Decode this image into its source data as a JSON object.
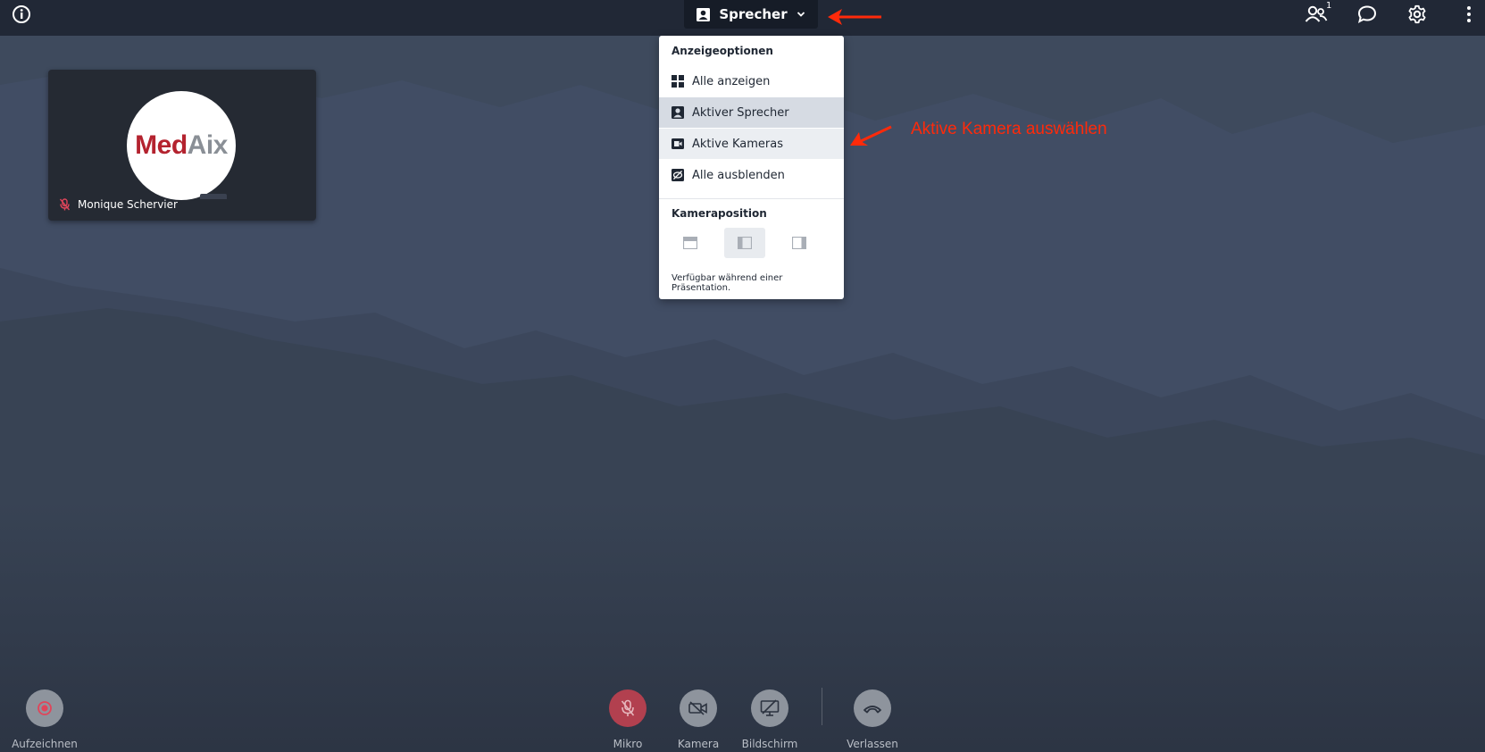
{
  "topbar": {
    "view_button_label": "Sprecher",
    "participants_count": "1",
    "icons": [
      "info-icon",
      "speaker-view-icon",
      "chevron-down-icon",
      "participants-icon",
      "chat-icon",
      "gear-icon",
      "more-vertical-icon"
    ]
  },
  "video_tile": {
    "participant_name": "Monique Schervier",
    "logo_text_red": "Med",
    "logo_text_gray": "Aix",
    "muted": true
  },
  "dropdown": {
    "section1_title": "Anzeigeoptionen",
    "items": [
      {
        "label": "Alle anzeigen",
        "icon": "grid-icon",
        "state": "normal"
      },
      {
        "label": "Aktiver Sprecher",
        "icon": "speaker-icon",
        "state": "selected"
      },
      {
        "label": "Aktive Kameras",
        "icon": "camera-icon",
        "state": "hover"
      },
      {
        "label": "Alle ausblenden",
        "icon": "hide-icon",
        "state": "normal"
      }
    ],
    "section2_title": "Kameraposition",
    "position_options": [
      "top",
      "left",
      "right"
    ],
    "selected_position": "left",
    "note": "Verfügbar während einer Präsentation."
  },
  "annotation": {
    "text": "Aktive Kamera auswählen",
    "color": "#ff2a0a"
  },
  "controls": {
    "record_label": "Aufzeichnen",
    "mic_label": "Mikro",
    "camera_label": "Kamera",
    "screen_label": "Bildschirm",
    "leave_label": "Verlassen"
  },
  "colors": {
    "topbar_bg": "#212836",
    "stage_bg": "#3e4a5d",
    "mic_muted": "#b2404f",
    "button_gray": "#8e949d",
    "selected_item_bg": "#d6dbe3"
  }
}
